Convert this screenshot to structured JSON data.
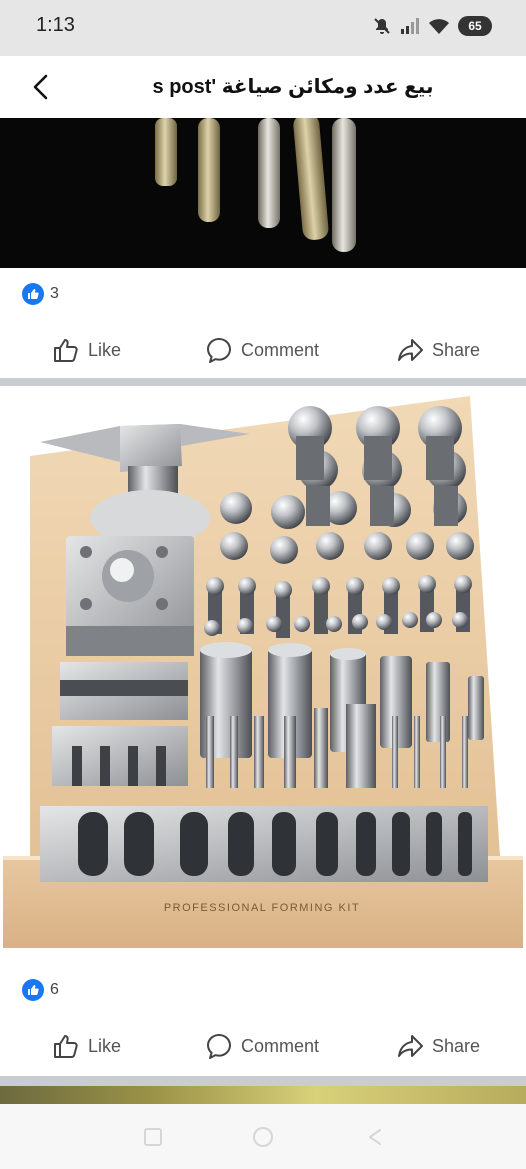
{
  "status_bar": {
    "time": "1:13",
    "battery": "65",
    "icons": [
      "mute-icon",
      "signal-icon",
      "wifi-icon",
      "battery-icon"
    ]
  },
  "header": {
    "title": "بيع عدد ومكائن صياغة 's post",
    "back_icon": "chevron-left-icon"
  },
  "posts": [
    {
      "reaction_count": "3",
      "actions": {
        "like": "Like",
        "comment": "Comment",
        "share": "Share"
      }
    },
    {
      "image_text": "Professional Forming Kit",
      "reaction_count": "6",
      "actions": {
        "like": "Like",
        "comment": "Comment",
        "share": "Share"
      }
    }
  ],
  "colors": {
    "accent": "#1877f2",
    "separator": "#c9ccd1",
    "status_bar": "#e6e6e6"
  },
  "nav": [
    "recents-icon",
    "home-icon",
    "back-icon"
  ]
}
